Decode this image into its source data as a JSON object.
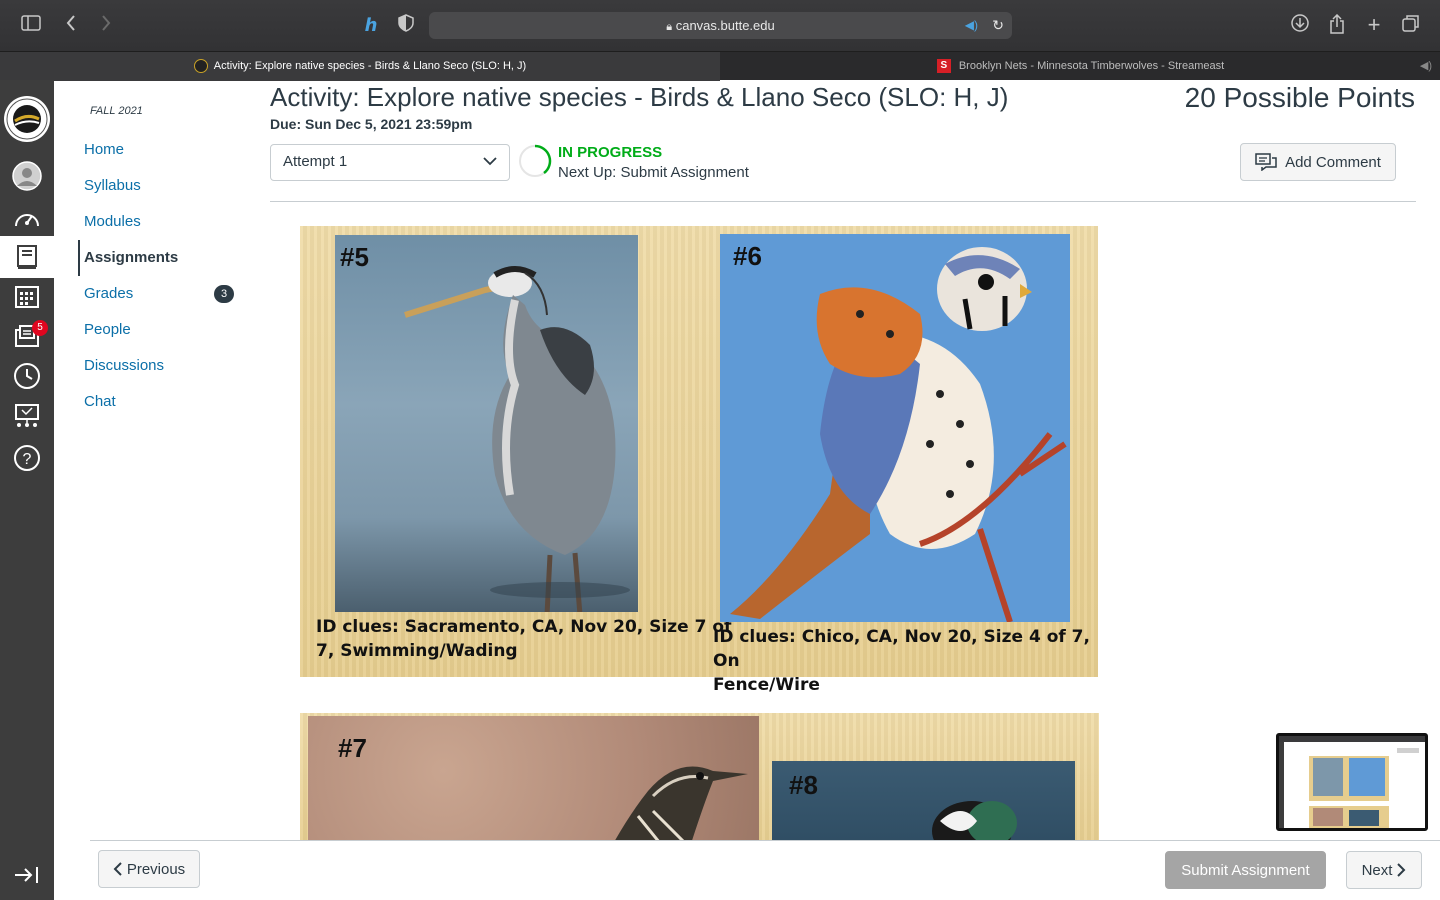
{
  "browser": {
    "url": "canvas.butte.edu",
    "tabs": [
      {
        "label": "Activity: Explore native species - Birds & Llano Seco (SLO: H, J)",
        "active": true
      },
      {
        "label": "Brooklyn Nets - Minnesota Timberwolves - Streameast",
        "active": false
      }
    ]
  },
  "global_nav": {
    "items": [
      "logo",
      "account-icon",
      "dashboard-icon",
      "courses-icon",
      "calendar-icon",
      "inbox-icon",
      "history-icon",
      "studio-icon",
      "help-icon"
    ],
    "inbox_badge": "5"
  },
  "course_nav": {
    "term": "FALL 2021",
    "items": [
      {
        "label": "Home"
      },
      {
        "label": "Syllabus"
      },
      {
        "label": "Modules"
      },
      {
        "label": "Assignments",
        "selected": true
      },
      {
        "label": "Grades",
        "badge": "3"
      },
      {
        "label": "People"
      },
      {
        "label": "Discussions"
      },
      {
        "label": "Chat"
      }
    ]
  },
  "assignment": {
    "title": "Activity: Explore native species - Birds & Llano Seco (SLO: H, J)",
    "points": "20 Possible Points",
    "due": "Due: Sun Dec 5, 2021 23:59pm",
    "attempt": "Attempt 1",
    "status": "IN PROGRESS",
    "next_up": "Next Up: Submit Assignment",
    "add_comment": "Add Comment"
  },
  "slides": [
    {
      "items": [
        {
          "number": "#5",
          "clue_line1": "ID clues: Sacramento, CA, Nov 20, Size 7 of",
          "clue_line2": "7, Swimming/Wading"
        },
        {
          "number": "#6",
          "clue_line1": "ID clues: Chico, CA, Nov 20, Size 4 of 7, On",
          "clue_line2": "Fence/Wire"
        }
      ]
    },
    {
      "items": [
        {
          "number": "#7"
        },
        {
          "number": "#8"
        }
      ]
    }
  ],
  "footer": {
    "previous": "Previous",
    "submit": "Submit Assignment",
    "next": "Next"
  },
  "colors": {
    "link": "#0b6fa8",
    "status": "#00ac18",
    "text": "#2d3b45",
    "global_nav": "#3d3d3d"
  }
}
